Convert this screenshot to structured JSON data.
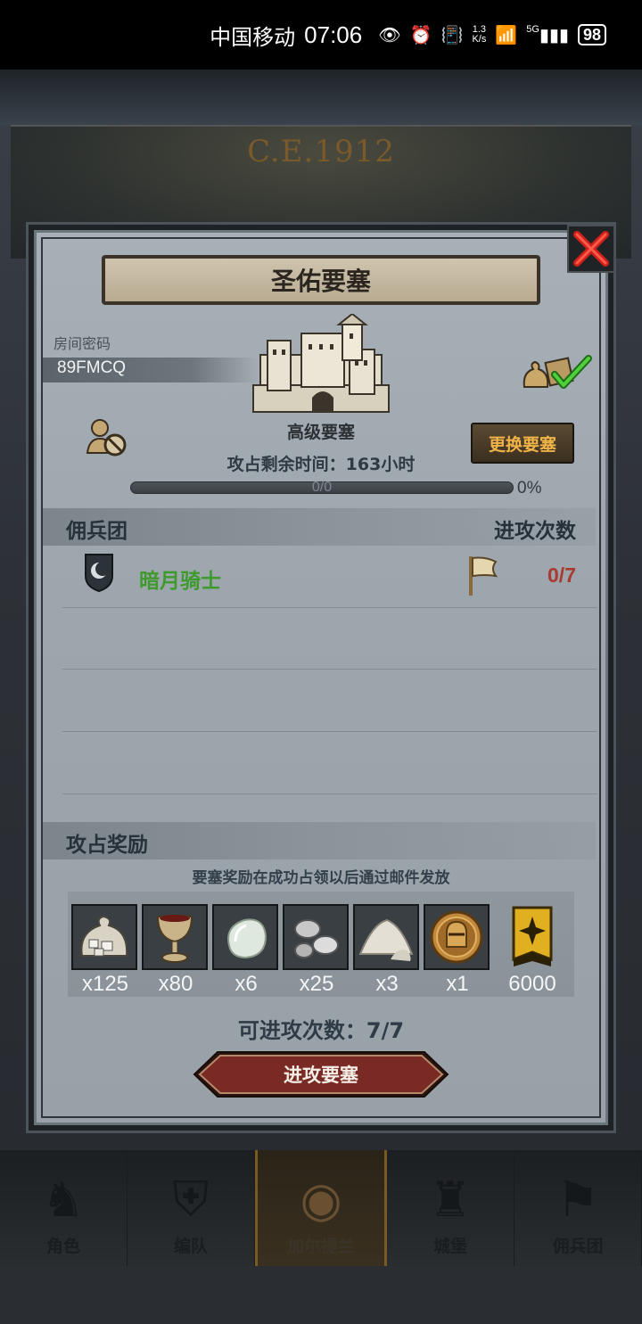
{
  "status_bar": {
    "carrier": "中国移动",
    "time": "07:06",
    "net_speed_value": "1.3",
    "net_speed_unit": "K/s",
    "signal_label": "5G",
    "battery": "98"
  },
  "background": {
    "era_text": "C.E.1912"
  },
  "dialog": {
    "title": "圣佑要塞",
    "room_label": "房间密码",
    "room_code": "89FMCQ",
    "fortress_level": "高级要塞",
    "change_button": "更换要塞",
    "remaining_time": "攻占剩余时间：163小时",
    "progress": {
      "text": "0/0",
      "percent_label": "0%",
      "fraction": 0
    },
    "mercenary_header": "佣兵团",
    "attack_count_header": "进攻次数",
    "mercenaries": [
      {
        "name": "暗月骑士",
        "attacks": "0/7"
      }
    ],
    "reward_header": "攻占奖励",
    "reward_note": "要塞奖励在成功占领以后通过邮件发放",
    "rewards": [
      {
        "icon": "ore-sack-icon",
        "qty": "x125"
      },
      {
        "icon": "goblet-icon",
        "qty": "x80"
      },
      {
        "icon": "moonstone-icon",
        "qty": "x6"
      },
      {
        "icon": "silver-ingots-icon",
        "qty": "x25"
      },
      {
        "icon": "powder-pile-icon",
        "qty": "x3"
      },
      {
        "icon": "knight-helmet-coin-icon",
        "qty": "x1"
      },
      {
        "icon": "honor-banner-icon",
        "qty": "6000"
      }
    ],
    "attempts_label": "可进攻次数：7/7",
    "attack_button": "进攻要塞"
  },
  "bottom_nav": {
    "items": [
      {
        "label": "角色",
        "active": false
      },
      {
        "label": "编队",
        "active": false
      },
      {
        "label": "加尔提兰",
        "active": true
      },
      {
        "label": "城堡",
        "active": false
      },
      {
        "label": "佣兵团",
        "active": false
      }
    ]
  },
  "colors": {
    "accent_gold": "#f0b348",
    "merc_name_green": "#3f9a2e",
    "attack_count_red": "#a83a30",
    "attack_button": "#7a2a24",
    "close_red": "#d0201a"
  }
}
